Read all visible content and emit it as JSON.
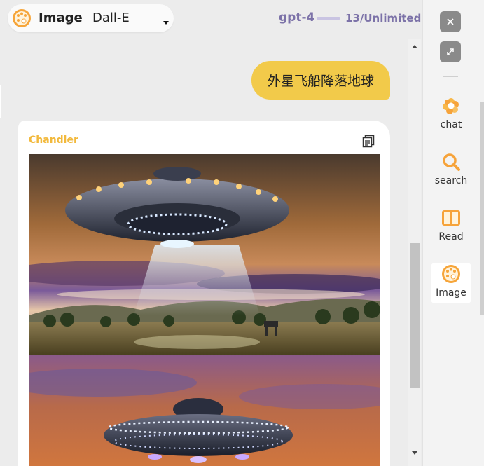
{
  "header": {
    "mode_label": "Image",
    "model_option": "Dall-E",
    "model_name": "gpt-4",
    "usage": "13/Unlimited"
  },
  "conversation": {
    "user_message": "外星飞船降落地球",
    "bot_name": "Chandler"
  },
  "sidebar": {
    "items": [
      {
        "label": "chat",
        "icon": "chat-swirl-icon"
      },
      {
        "label": "search",
        "icon": "search-icon"
      },
      {
        "label": "Read",
        "icon": "book-icon"
      },
      {
        "label": "Image",
        "icon": "palette-icon",
        "active": true
      }
    ],
    "window_buttons": [
      "close-icon",
      "expand-icon"
    ]
  },
  "colors": {
    "accent": "#f2ca4a",
    "bot_name": "#f2b93c",
    "model_text": "#7c72a8",
    "background": "#ececec"
  }
}
